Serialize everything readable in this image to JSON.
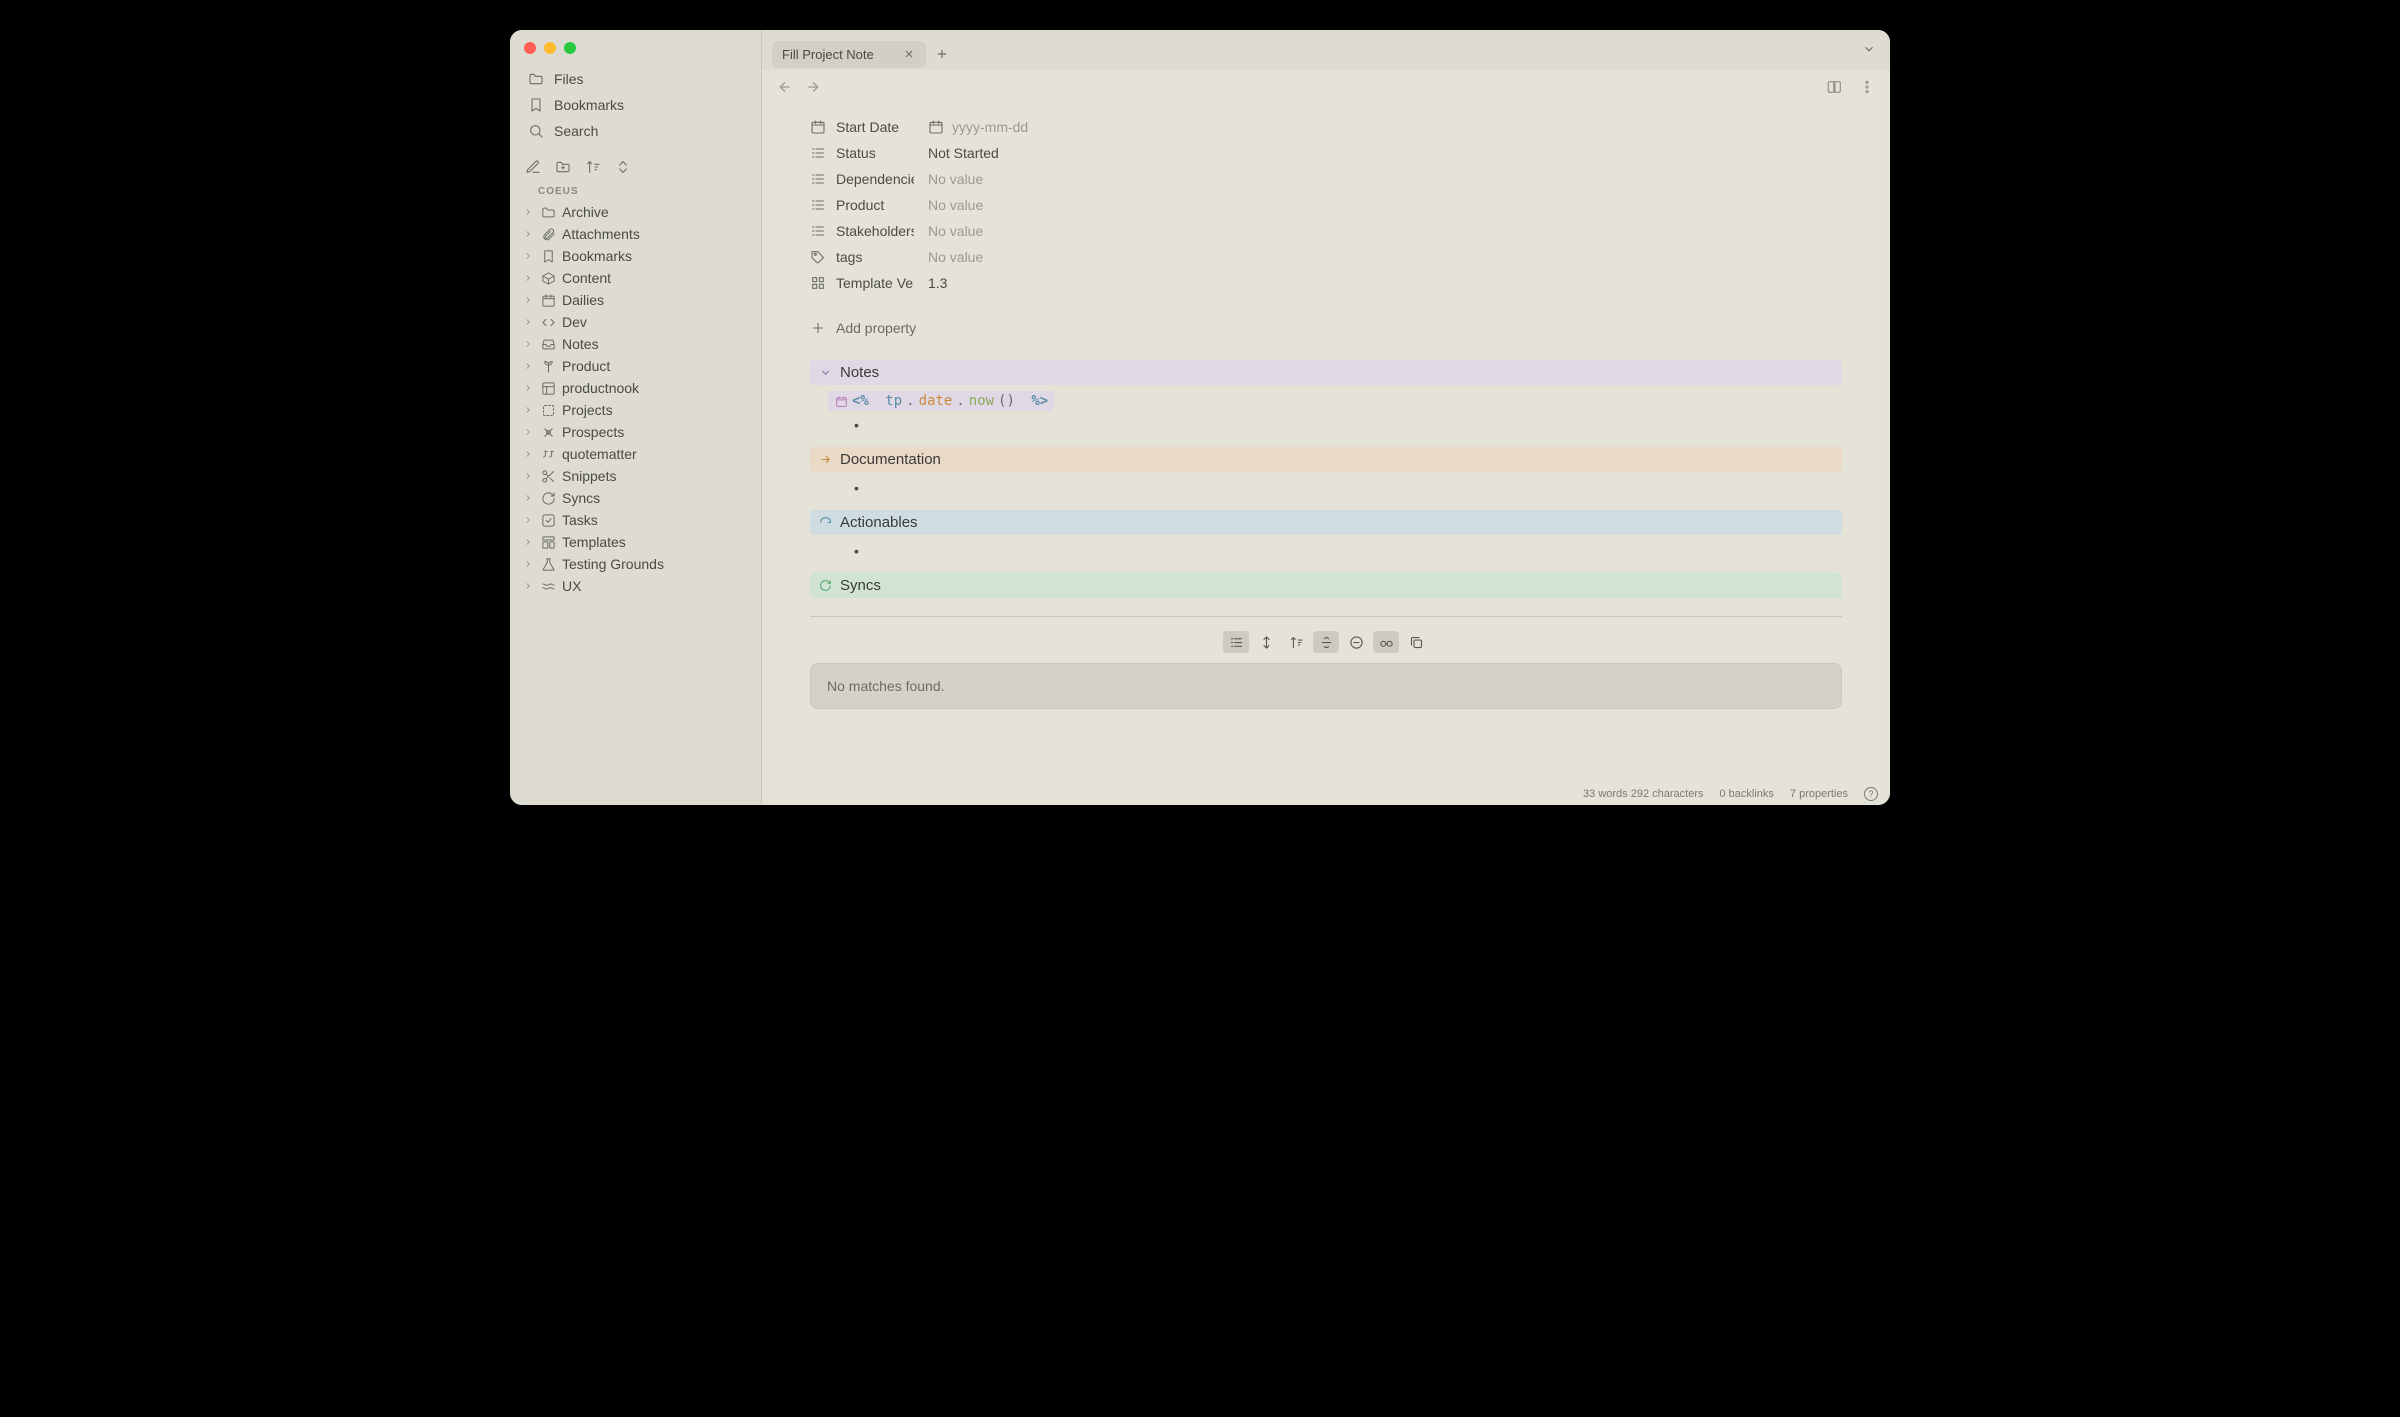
{
  "sidebar": {
    "top": [
      {
        "icon": "folder",
        "label": "Files"
      },
      {
        "icon": "bookmark",
        "label": "Bookmarks"
      },
      {
        "icon": "search",
        "label": "Search"
      }
    ],
    "vault_label": "COEUS",
    "tree": [
      {
        "icon": "folder",
        "label": "Archive"
      },
      {
        "icon": "paperclip",
        "label": "Attachments"
      },
      {
        "icon": "bookmark",
        "label": "Bookmarks"
      },
      {
        "icon": "box",
        "label": "Content"
      },
      {
        "icon": "calendar",
        "label": "Dailies"
      },
      {
        "icon": "code",
        "label": "Dev"
      },
      {
        "icon": "inbox",
        "label": "Notes"
      },
      {
        "icon": "plant",
        "label": "Product"
      },
      {
        "icon": "layout",
        "label": "productnook"
      },
      {
        "icon": "dashed",
        "label": "Projects"
      },
      {
        "icon": "crosshair",
        "label": "Prospects"
      },
      {
        "icon": "quote",
        "label": "quotematter"
      },
      {
        "icon": "scissors",
        "label": "Snippets"
      },
      {
        "icon": "refresh",
        "label": "Syncs"
      },
      {
        "icon": "check",
        "label": "Tasks"
      },
      {
        "icon": "template",
        "label": "Templates"
      },
      {
        "icon": "flask",
        "label": "Testing Grounds"
      },
      {
        "icon": "waves",
        "label": "UX"
      }
    ]
  },
  "tab": {
    "title": "Fill Project Note"
  },
  "properties": [
    {
      "key": "Start Date",
      "icon": "calendar",
      "value": "",
      "placeholder": "yyyy-mm-dd",
      "type": "date"
    },
    {
      "key": "Status",
      "icon": "list",
      "value": "Not Started",
      "type": "text"
    },
    {
      "key": "Dependencies",
      "icon": "list",
      "value": "",
      "placeholder": "No value",
      "type": "novalue"
    },
    {
      "key": "Product",
      "icon": "list",
      "value": "",
      "placeholder": "No value",
      "type": "novalue"
    },
    {
      "key": "Stakeholders",
      "icon": "list",
      "value": "",
      "placeholder": "No value",
      "type": "novalue"
    },
    {
      "key": "tags",
      "icon": "tag",
      "value": "",
      "placeholder": "No value",
      "type": "novalue"
    },
    {
      "key": "Template Vers…",
      "icon": "grid",
      "value": "1.3",
      "type": "text"
    }
  ],
  "add_property": "Add property",
  "sections": {
    "notes": "Notes",
    "documentation": "Documentation",
    "actionables": "Actionables",
    "syncs": "Syncs"
  },
  "code": {
    "open": "<%",
    "tp": "tp",
    "dot1": ".",
    "date": "date",
    "dot2": ".",
    "now": "now",
    "paren": "()",
    "close": "%>"
  },
  "results": {
    "empty": "No matches found."
  },
  "statusbar": {
    "words": "33 words 292 characters",
    "backlinks": "0 backlinks",
    "properties": "7 properties"
  }
}
